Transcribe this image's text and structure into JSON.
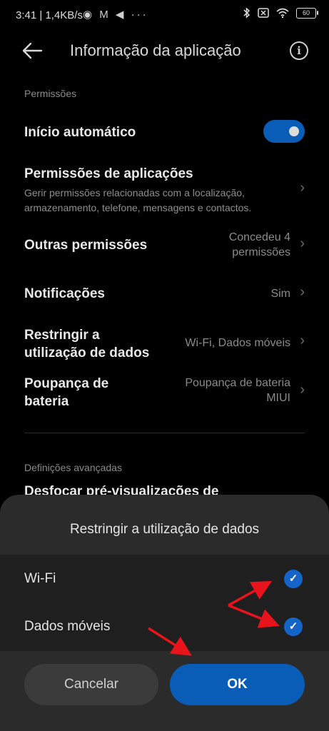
{
  "status_bar": {
    "time": "3:41",
    "speed": "1,4KB/s",
    "left_icons": "◉ M ◀ ···",
    "battery": "60"
  },
  "header": {
    "title": "Informação da aplicação"
  },
  "permissions": {
    "section_label": "Permissões",
    "autostart": {
      "label": "Início automático",
      "enabled": true
    },
    "app_permissions": {
      "label": "Permissões de aplicações",
      "sub1": "Gerir permissões relacionadas com a localização,",
      "sub2": "armazenamento, telefone, mensagens e contactos."
    },
    "other_permissions": {
      "label": "Outras permissões",
      "value1": "Concedeu 4",
      "value2": "permissões"
    },
    "notifications": {
      "label": "Notificações",
      "value": "Sim"
    },
    "data_usage": {
      "label1": "Restringir a",
      "label2": "utilização de dados",
      "value": "Wi-Fi, Dados móveis"
    },
    "battery_saver": {
      "label1": "Poupança de",
      "label2": "bateria",
      "value1": "Poupança de bateria",
      "value2": "MIUI"
    }
  },
  "advanced": {
    "section_label": "Definições avançadas",
    "partial_item": "Desfocar pré-visualizações de"
  },
  "dialog": {
    "title": "Restringir a utilização de dados",
    "options": [
      {
        "label": "Wi-Fi",
        "checked": true
      },
      {
        "label": "Dados móveis",
        "checked": true
      }
    ],
    "cancel_label": "Cancelar",
    "ok_label": "OK"
  },
  "colors": {
    "accent": "#0a5db7",
    "annotation_arrow": "#e8141b"
  }
}
